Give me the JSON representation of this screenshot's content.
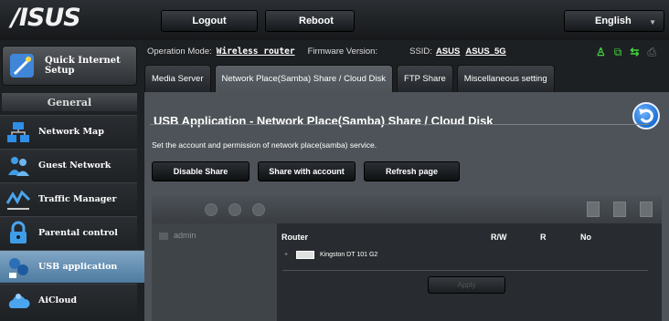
{
  "brand": {
    "logo": "/ISUS"
  },
  "topbar": {
    "logout_label": "Logout",
    "reboot_label": "Reboot",
    "language": "English"
  },
  "info": {
    "operation_mode_label": "Operation Mode:",
    "operation_mode_value": "Wireless router",
    "firmware_label": "Firmware Version:",
    "ssid_label": "SSID:",
    "ssid_1": "ASUS",
    "ssid_2": "ASUS_5G"
  },
  "status_icons": [
    "user-icon",
    "copy-icon",
    "usb-icon",
    "printer-icon"
  ],
  "sidebar": {
    "quick_setup": "Quick Internet Setup",
    "section_label": "General",
    "items": [
      {
        "label": "Network Map",
        "icon": "network-map-icon"
      },
      {
        "label": "Guest Network",
        "icon": "guest-network-icon"
      },
      {
        "label": "Traffic Manager",
        "icon": "traffic-manager-icon"
      },
      {
        "label": "Parental control",
        "icon": "lock-icon"
      },
      {
        "label": "USB application",
        "icon": "usb-app-icon",
        "active": true
      },
      {
        "label": "AiCloud",
        "icon": "cloud-icon"
      }
    ]
  },
  "tabs": [
    {
      "label": "Media Server"
    },
    {
      "label": "Network Place(Samba) Share / Cloud Disk",
      "active": true
    },
    {
      "label": "FTP Share"
    },
    {
      "label": "Miscellaneous setting"
    }
  ],
  "panel": {
    "title": "USB Application - Network Place(Samba) Share / Cloud Disk",
    "description": "Set the account and permission of network place(samba) service.",
    "buttons": {
      "disable_share": "Disable Share",
      "share_with_account": "Share with account",
      "refresh_page": "Refresh page"
    }
  },
  "share": {
    "account": "admin",
    "columns": {
      "router": "Router",
      "rw": "R/W",
      "r": "R",
      "no": "No"
    },
    "device": "Kingston DT 101 G2",
    "apply_label": "Apply"
  },
  "colors": {
    "accent_active": "#5d87ab",
    "status_green": "#43d33d",
    "back_button": "#1c6fd0"
  }
}
